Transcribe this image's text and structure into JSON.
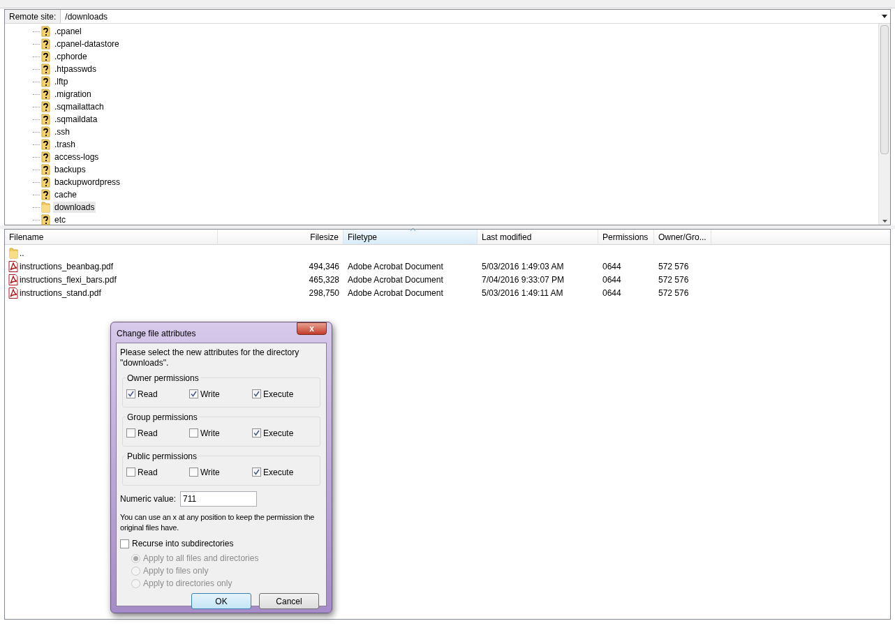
{
  "remote_site": {
    "label": "Remote site:",
    "path": "/downloads"
  },
  "tree": [
    {
      "name": ".cpanel",
      "kind": "unknown",
      "selected": false
    },
    {
      "name": ".cpanel-datastore",
      "kind": "unknown",
      "selected": false
    },
    {
      "name": ".cphorde",
      "kind": "unknown",
      "selected": false
    },
    {
      "name": ".htpasswds",
      "kind": "unknown",
      "selected": false
    },
    {
      "name": ".lftp",
      "kind": "unknown",
      "selected": false
    },
    {
      "name": ".migration",
      "kind": "unknown",
      "selected": false
    },
    {
      "name": ".sqmailattach",
      "kind": "unknown",
      "selected": false
    },
    {
      "name": ".sqmaildata",
      "kind": "unknown",
      "selected": false
    },
    {
      "name": ".ssh",
      "kind": "unknown",
      "selected": false
    },
    {
      "name": ".trash",
      "kind": "unknown",
      "selected": false
    },
    {
      "name": "access-logs",
      "kind": "unknown",
      "selected": false
    },
    {
      "name": "backups",
      "kind": "unknown",
      "selected": false
    },
    {
      "name": "backupwordpress",
      "kind": "unknown",
      "selected": false
    },
    {
      "name": "cache",
      "kind": "unknown",
      "selected": false
    },
    {
      "name": "downloads",
      "kind": "folder",
      "selected": true
    },
    {
      "name": "etc",
      "kind": "unknown",
      "selected": false
    }
  ],
  "file_list": {
    "columns": [
      {
        "label": "Filename",
        "sorted": false
      },
      {
        "label": "Filesize",
        "sorted": false
      },
      {
        "label": "Filetype",
        "sorted": true
      },
      {
        "label": "Last modified",
        "sorted": false
      },
      {
        "label": "Permissions",
        "sorted": false
      },
      {
        "label": "Owner/Gro...",
        "sorted": false
      }
    ],
    "rows": [
      {
        "kind": "folder",
        "filename": "..",
        "filesize": "",
        "filetype": "",
        "last_modified": "",
        "permissions": "",
        "owner": ""
      },
      {
        "kind": "pdf",
        "filename": "instructions_beanbag.pdf",
        "filesize": "494,346",
        "filetype": "Adobe Acrobat Document",
        "last_modified": "5/03/2016 1:49:03 AM",
        "permissions": "0644",
        "owner": "572 576"
      },
      {
        "kind": "pdf",
        "filename": "instructions_flexi_bars.pdf",
        "filesize": "465,328",
        "filetype": "Adobe Acrobat Document",
        "last_modified": "7/04/2016 9:33:07 PM",
        "permissions": "0644",
        "owner": "572 576"
      },
      {
        "kind": "pdf",
        "filename": "instructions_stand.pdf",
        "filesize": "298,750",
        "filetype": "Adobe Acrobat Document",
        "last_modified": "5/03/2016 1:49:11 AM",
        "permissions": "0644",
        "owner": "572 576"
      }
    ]
  },
  "dialog": {
    "title": "Change file attributes",
    "close": "x",
    "intro": "Please select the new attributes for the directory \"downloads\".",
    "groups": [
      {
        "title": "Owner permissions",
        "options": [
          {
            "label": "Read",
            "checked": true
          },
          {
            "label": "Write",
            "checked": true
          },
          {
            "label": "Execute",
            "checked": true
          }
        ]
      },
      {
        "title": "Group permissions",
        "options": [
          {
            "label": "Read",
            "checked": false
          },
          {
            "label": "Write",
            "checked": false
          },
          {
            "label": "Execute",
            "checked": true
          }
        ]
      },
      {
        "title": "Public permissions",
        "options": [
          {
            "label": "Read",
            "checked": false
          },
          {
            "label": "Write",
            "checked": false
          },
          {
            "label": "Execute",
            "checked": true
          }
        ]
      }
    ],
    "numeric_label": "Numeric value:",
    "numeric_value": "711",
    "hint": "You can use an x at any position to keep the permission the original files have.",
    "recurse": {
      "label": "Recurse into subdirectories",
      "checked": false
    },
    "apply_options": [
      {
        "label": "Apply to all files and directories",
        "selected": true,
        "disabled": true
      },
      {
        "label": "Apply to files only",
        "selected": false,
        "disabled": true
      },
      {
        "label": "Apply to directories only",
        "selected": false,
        "disabled": true
      }
    ],
    "buttons": [
      {
        "label": "OK",
        "kind": "default"
      },
      {
        "label": "Cancel",
        "kind": "normal"
      }
    ]
  }
}
